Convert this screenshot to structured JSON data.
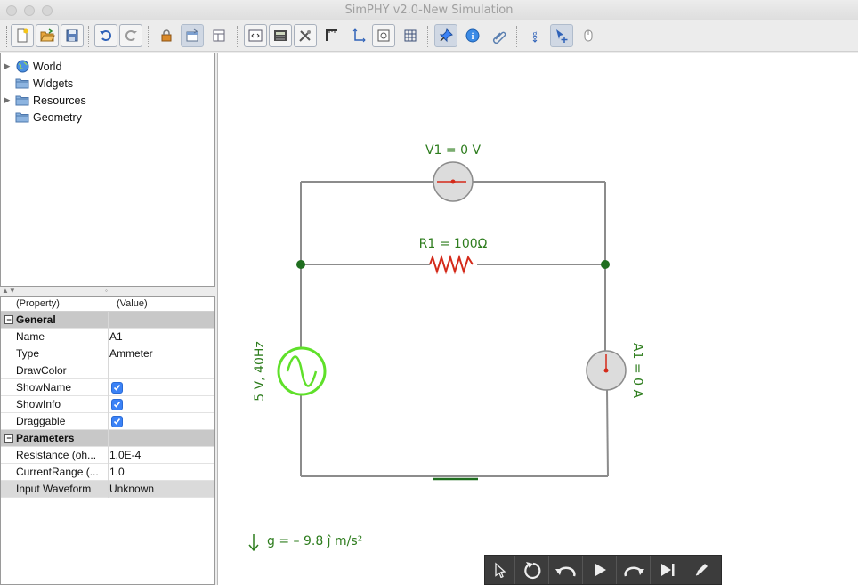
{
  "window": {
    "title": "SimPHY v2.0-New Simulation"
  },
  "toolbar": {
    "buttons": [
      "new-icon",
      "open-icon",
      "save-icon",
      "undo-icon",
      "redo-icon",
      "lock-icon",
      "properties-icon",
      "layout-icon",
      "code-icon",
      "calculator-icon",
      "tools-icon",
      "ruler-icon",
      "axes-icon",
      "snapshot-icon",
      "grid-icon",
      "pin-icon",
      "info-icon",
      "clip-icon",
      "gravity-icon",
      "select-move-icon",
      "mouse-icon"
    ]
  },
  "tree": {
    "items": [
      {
        "label": "World",
        "icon": "globe-icon",
        "expandable": true
      },
      {
        "label": "Widgets",
        "icon": "folder-icon",
        "expandable": false
      },
      {
        "label": "Resources",
        "icon": "folder-icon",
        "expandable": true
      },
      {
        "label": "Geometry",
        "icon": "folder-icon",
        "expandable": false
      }
    ]
  },
  "properties": {
    "header_property": "(Property)",
    "header_value": "(Value)",
    "general_label": "General",
    "rows_general": [
      {
        "key": "Name",
        "value": "A1",
        "type": "text"
      },
      {
        "key": "Type",
        "value": "Ammeter",
        "type": "text"
      },
      {
        "key": "DrawColor",
        "value": "",
        "type": "text"
      },
      {
        "key": "ShowName",
        "value": "",
        "type": "check"
      },
      {
        "key": "ShowInfo",
        "value": "",
        "type": "check"
      },
      {
        "key": "Draggable",
        "value": "",
        "type": "check"
      }
    ],
    "parameters_label": "Parameters",
    "rows_parameters": [
      {
        "key": "Resistance (oh...",
        "value": "1.0E-4"
      },
      {
        "key": "CurrentRange (...",
        "value": "1.0"
      },
      {
        "key": "Input Waveform",
        "value": "Unknown"
      }
    ]
  },
  "canvas": {
    "voltmeter_label": "V1 = 0 V",
    "resistor_label": "R1 = 100Ω",
    "source_label": "5 V, 40Hz",
    "ammeter_label": "A1 = 0 A",
    "gravity_label": "g = – 9.8 ĵ m/s²",
    "colors": {
      "label_green": "#2e7d1e",
      "wire": "#8c8c8c",
      "node": "#1f6e1f",
      "resistor": "#d42a1a",
      "source": "#5fe02a",
      "meter_needle": "#d42a1a"
    }
  },
  "player": {
    "buttons": [
      "pointer-icon",
      "reset-icon",
      "undo-step-icon",
      "play-icon",
      "redo-step-icon",
      "step-end-icon",
      "pen-icon"
    ]
  }
}
